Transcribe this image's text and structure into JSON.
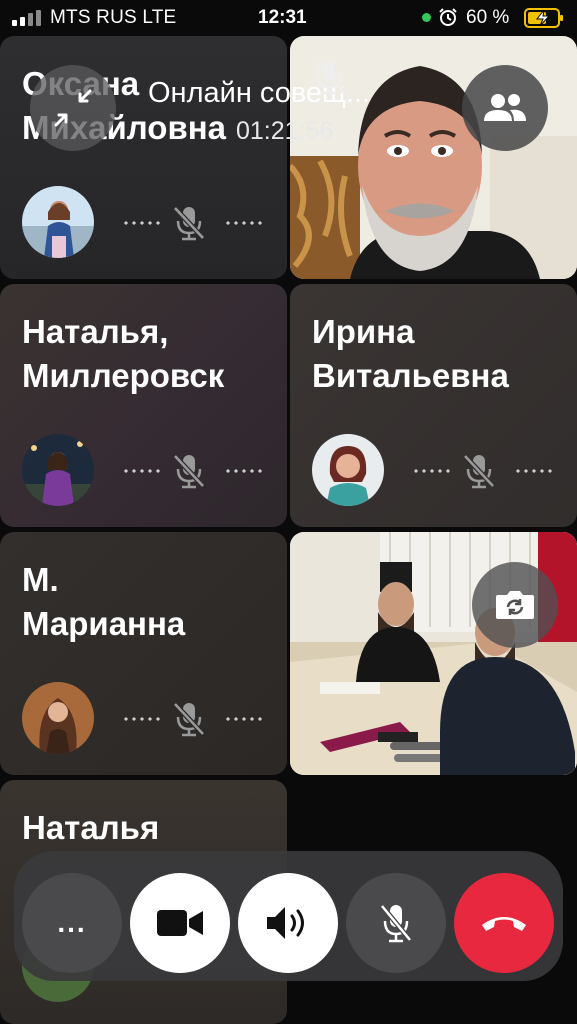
{
  "status_bar": {
    "carrier": "MTS RUS  LTE",
    "time": "12:31",
    "battery": "60 %",
    "icons": [
      "signal-icon",
      "alarm-icon",
      "battery-charging-icon"
    ]
  },
  "header": {
    "title": "Онлайн совещ...",
    "timer": "01:21:56"
  },
  "participants": [
    {
      "name": "Оксана Михайловна",
      "line1": "Оксана",
      "line2": "Михайловна",
      "muted": true
    },
    {
      "name": "video",
      "muted": true
    },
    {
      "name": "Наталья, Миллеровск",
      "line1": "Наталья,",
      "line2": "Миллеровск",
      "muted": true
    },
    {
      "name": "Ирина Витальевна",
      "line1": "Ирина",
      "line2": "Витальевна",
      "muted": true
    },
    {
      "name": "М. Марианна",
      "line1": "М.",
      "line2": "Марианна",
      "muted": true
    },
    {
      "name": "video-room",
      "muted": false
    },
    {
      "name": "Наталья",
      "line1": "Наталья",
      "line2": "",
      "muted": true
    }
  ],
  "controls": {
    "more": "...",
    "items": [
      "more-icon",
      "video-camera-icon",
      "speaker-icon",
      "mic-off-icon",
      "hang-up-icon"
    ]
  },
  "colors": {
    "hangup": "#e8283f",
    "background": "#0a0a0b",
    "tile": "#2a2828"
  }
}
